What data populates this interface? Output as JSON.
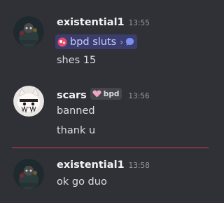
{
  "colors": {
    "background": "#303136",
    "username": "#f2f3f5",
    "text": "#dbdee1",
    "timestamp": "#949ba4",
    "channel_chip_bg": "#3b3d6d",
    "channel_chip_text": "#c9cdfb",
    "role_tag_bg": "#44464b",
    "role_heart": "#f0a3c8",
    "new_messages_divider": "#c4424c"
  },
  "messages": [
    {
      "author": "existential1",
      "time": "13:55",
      "avatar_icon": "dark-character-avatar-icon",
      "channel_link": {
        "icon": "channel-emoji-icon",
        "label": "bpd sluts",
        "chevron": "›",
        "trailing_icon": "speech-bubble-icon"
      },
      "lines": [
        "shes 15"
      ]
    },
    {
      "author": "scars",
      "time": "13:56",
      "avatar_icon": "white-cat-avatar-icon",
      "role_tag": {
        "icon": "pink-heart-icon",
        "label": "bpd"
      },
      "lines": [
        "banned",
        "thank u"
      ]
    },
    {
      "author": "existential1",
      "time": "13:58",
      "avatar_icon": "dark-character-avatar-icon",
      "lines": [
        "ok go duo"
      ]
    }
  ]
}
